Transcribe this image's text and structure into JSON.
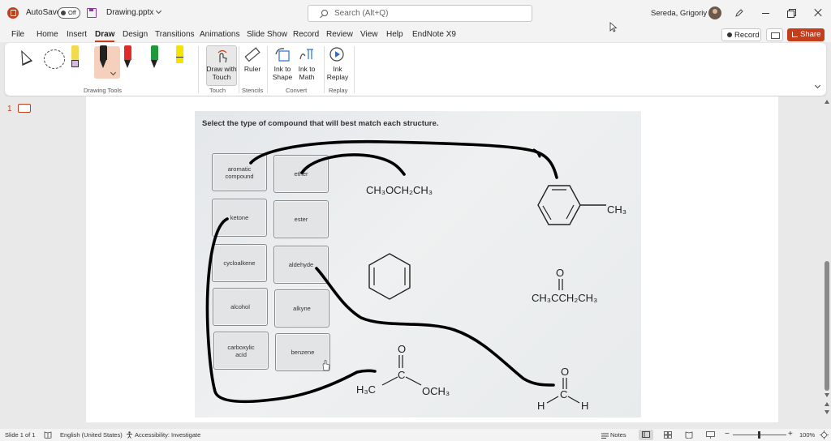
{
  "titlebar": {
    "autosave_label": "AutoSave",
    "autosave_state": "Off",
    "filename": "Drawing.pptx",
    "search_placeholder": "Search (Alt+Q)",
    "user_name": "Sereda, Grigoriy A"
  },
  "menu": {
    "tabs": [
      "File",
      "Home",
      "Insert",
      "Draw",
      "Design",
      "Transitions",
      "Animations",
      "Slide Show",
      "Record",
      "Review",
      "View",
      "Help",
      "EndNote X9"
    ],
    "active_tab": "Draw",
    "record_label": "Record",
    "share_label": "Share"
  },
  "ribbon": {
    "groups": {
      "drawing_tools": "Drawing Tools",
      "touch": "Touch",
      "stencils": "Stencils",
      "convert": "Convert",
      "replay": "Replay"
    },
    "draw_with_touch_line1": "Draw with",
    "draw_with_touch_line2": "Touch",
    "ruler": "Ruler",
    "ink_to_shape_line1": "Ink to",
    "ink_to_shape_line2": "Shape",
    "ink_to_math_line1": "Ink to",
    "ink_to_math_line2": "Math",
    "ink_replay_line1": "Ink",
    "ink_replay_line2": "Replay",
    "pens": [
      {
        "color": "#f2d94e",
        "tip": "#e8c6f0"
      },
      {
        "color": "#222222",
        "tip": "#222222"
      },
      {
        "color": "#e02b2b",
        "tip": "#222222"
      },
      {
        "color": "#1f9a3a",
        "tip": "#222222"
      },
      {
        "color": "#f5e400",
        "tip": "#222222"
      }
    ]
  },
  "slides": {
    "current_number": "1"
  },
  "slide_content": {
    "question": "Select the type of compound that will best match each structure.",
    "boxes": [
      {
        "label_line1": "aromatic",
        "label_line2": "compound"
      },
      {
        "label_line1": "ether",
        "label_line2": ""
      },
      {
        "label_line1": "ketone",
        "label_line2": ""
      },
      {
        "label_line1": "ester",
        "label_line2": ""
      },
      {
        "label_line1": "cycloalkene",
        "label_line2": ""
      },
      {
        "label_line1": "aldehyde",
        "label_line2": ""
      },
      {
        "label_line1": "alcohol",
        "label_line2": ""
      },
      {
        "label_line1": "alkyne",
        "label_line2": ""
      },
      {
        "label_line1": "carboxylic",
        "label_line2": "acid"
      },
      {
        "label_line1": "benzene",
        "label_line2": ""
      }
    ],
    "structures": {
      "ether": "CH₃OCH₂CH₃",
      "toluene_ch3": "CH₃",
      "ketone_o": "O",
      "ketone": "CH₃CCH₂CH₃",
      "ester_o": "O",
      "ester_h3c": "H₃C",
      "ester_c": "C",
      "ester_och3": "OCH₃",
      "aldehyde_o": "O",
      "aldehyde_c": "C",
      "aldehyde_h_left": "H",
      "aldehyde_h_right": "H"
    }
  },
  "statusbar": {
    "slide_info": "Slide 1 of 1",
    "language": "English (United States)",
    "accessibility": "Accessibility: Investigate",
    "notes": "Notes",
    "zoom": "100%"
  },
  "colors": {
    "accent": "#c43e1c",
    "ink": "#000000"
  }
}
